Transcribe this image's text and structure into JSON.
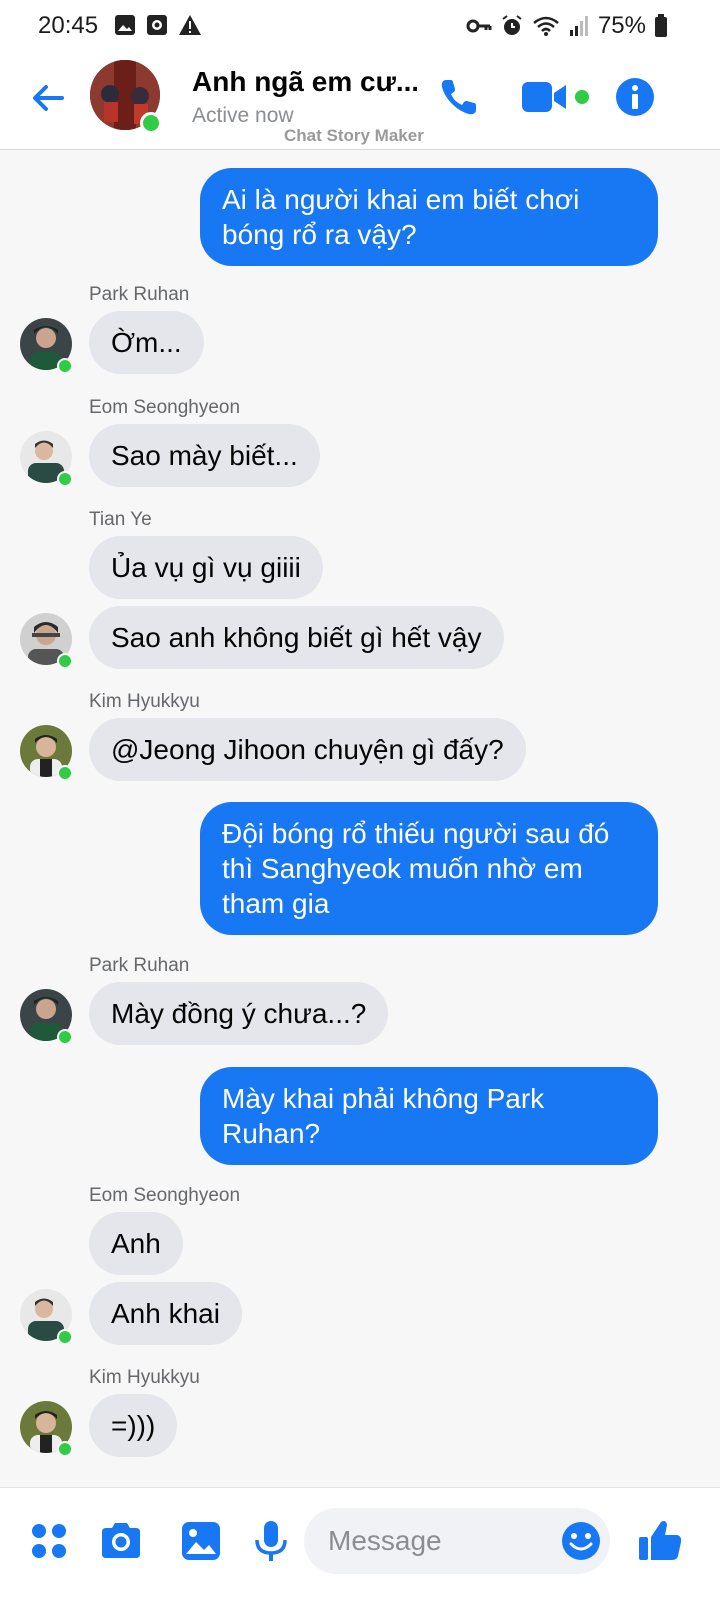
{
  "status_bar": {
    "time": "20:45",
    "battery": "75%"
  },
  "header": {
    "title": "Anh ngã em cư...",
    "status": "Active now",
    "watermark": "Chat Story Maker"
  },
  "colors": {
    "accent": "#1877f2",
    "outgoing_bubble": "#1877f2",
    "incoming_bubble": "#e4e6eb",
    "online": "#31cc46"
  },
  "messages": [
    {
      "id": "m1",
      "direction": "out",
      "text": "Ai là người khai em biết chơi bóng rổ ra vậy?"
    },
    {
      "id": "m2",
      "direction": "in",
      "sender": "Park Ruhan",
      "text": "Ờm..."
    },
    {
      "id": "m3",
      "direction": "in",
      "sender": "Eom Seonghyeon",
      "text": "Sao mày biết..."
    },
    {
      "id": "m4",
      "direction": "in",
      "sender": "Tian Ye",
      "text": "Ủa vụ gì vụ giiii"
    },
    {
      "id": "m5",
      "direction": "in",
      "sender": "Tian Ye",
      "text": "Sao anh không biết gì hết vậy"
    },
    {
      "id": "m6",
      "direction": "in",
      "sender": "Kim Hyukkyu",
      "text": "@Jeong Jihoon chuyện gì đấy?"
    },
    {
      "id": "m7",
      "direction": "out",
      "text": "Đội bóng rổ thiếu người sau đó thì Sanghyeok muốn nhờ em tham gia"
    },
    {
      "id": "m8",
      "direction": "in",
      "sender": "Park Ruhan",
      "text": "Mày đồng ý chưa...?"
    },
    {
      "id": "m9",
      "direction": "out",
      "text": "Mày khai phải không Park Ruhan?"
    },
    {
      "id": "m10",
      "direction": "in",
      "sender": "Eom Seonghyeon",
      "text": "Anh"
    },
    {
      "id": "m11",
      "direction": "in",
      "sender": "Eom Seonghyeon",
      "text": "Anh khai"
    },
    {
      "id": "m12",
      "direction": "in",
      "sender": "Kim Hyukkyu",
      "text": "=)))"
    }
  ],
  "sender_labels": {
    "s1": "Park Ruhan",
    "s2": "Eom Seonghyeon",
    "s3": "Tian Ye",
    "s4": "Kim Hyukkyu",
    "s5": "Park Ruhan",
    "s6": "Eom Seonghyeon",
    "s7": "Kim Hyukkyu"
  },
  "composer": {
    "placeholder": "Message",
    "icons": [
      "apps-icon",
      "camera-icon",
      "gallery-icon",
      "microphone-icon",
      "emoji-icon",
      "thumbs-up-icon"
    ]
  }
}
